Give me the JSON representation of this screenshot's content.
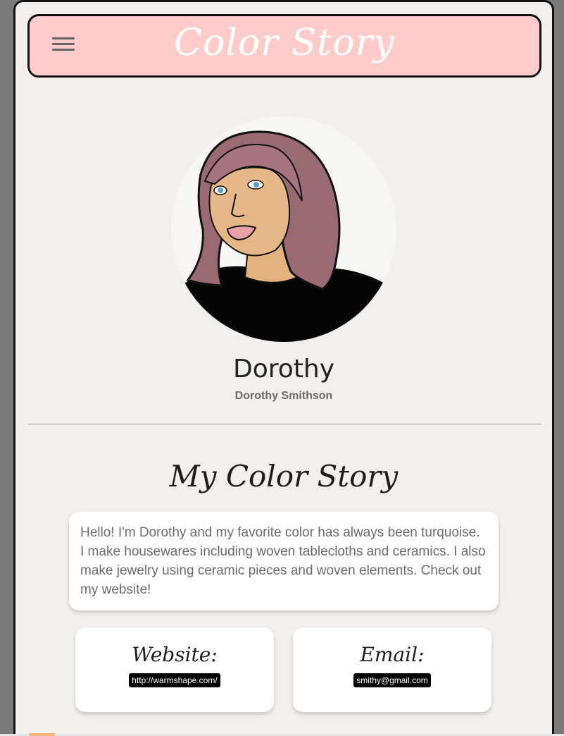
{
  "header": {
    "title": "Color Story",
    "menu_icon": "hamburger-menu-icon",
    "background_color": "#ffcccb"
  },
  "profile": {
    "display_name": "Dorothy",
    "full_name": "Dorothy Smithson"
  },
  "story": {
    "title": "My Color Story",
    "bio": "Hello! I'm Dorothy and my favorite color has always been turquoise. I make housewares including woven tablecloths and ceramics. I also make jewelry using ceramic pieces and woven elements. Check out my website!"
  },
  "contact": {
    "website_label": "Website:",
    "website_value": "http://warmshape.com/",
    "email_label": "Email:",
    "email_value": "smithy@gmail.com"
  },
  "colors": {
    "page_background": "#f3efec",
    "header_background": "#ffcccb",
    "text_dark": "#222222",
    "text_muted": "#6b6b6b"
  }
}
